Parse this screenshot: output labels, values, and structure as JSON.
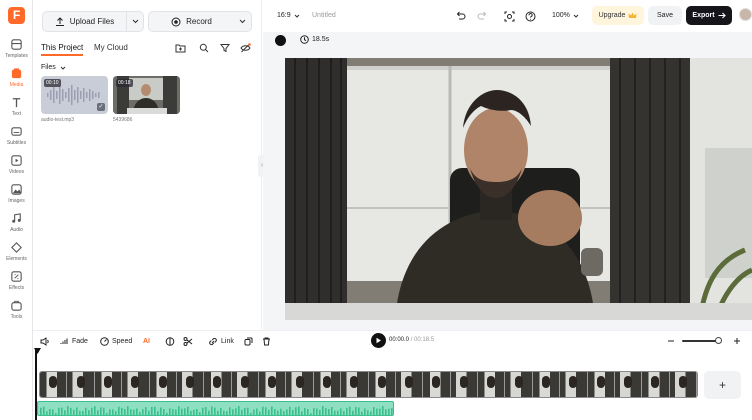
{
  "app": {
    "logo_letter": "F"
  },
  "rail": {
    "items": [
      {
        "label": "Templates",
        "icon": "templates-icon"
      },
      {
        "label": "Media",
        "icon": "media-icon",
        "active": true
      },
      {
        "label": "Text",
        "icon": "text-icon"
      },
      {
        "label": "Subtitles",
        "icon": "subtitles-icon"
      },
      {
        "label": "Videos",
        "icon": "videos-icon"
      },
      {
        "label": "Images",
        "icon": "images-icon"
      },
      {
        "label": "Audio",
        "icon": "audio-icon"
      },
      {
        "label": "Elements",
        "icon": "elements-icon"
      },
      {
        "label": "Effects",
        "icon": "effects-icon"
      },
      {
        "label": "Tools",
        "icon": "tools-icon"
      }
    ]
  },
  "panel": {
    "upload_label": "Upload Files",
    "record_label": "Record",
    "tabs": [
      {
        "label": "This Project",
        "active": true
      },
      {
        "label": "My Cloud"
      }
    ],
    "files_label": "Files",
    "files": [
      {
        "name": "audio-test.mp3",
        "duration": "00:10",
        "type": "audio"
      },
      {
        "name": "5439686",
        "duration": "00:18",
        "type": "video"
      }
    ]
  },
  "topbar": {
    "aspect": "16:9",
    "title": "Untitled",
    "zoom": "100%",
    "upgrade_label": "Upgrade",
    "save_label": "Save",
    "export_label": "Export"
  },
  "canvas": {
    "duration": "18.5s",
    "background_color": "#111111"
  },
  "timeline_toolbar": {
    "fade_label": "Fade",
    "speed_label": "Speed",
    "ai_label": "AI",
    "link_label": "Link",
    "current_time": "00:00.0",
    "total_time": "/ 00:18.5"
  },
  "timeline": {
    "add_label": "+"
  },
  "colors": {
    "accent": "#ff6a2b",
    "audio_track": "#8fe0c3",
    "export_bg": "#15151a"
  }
}
